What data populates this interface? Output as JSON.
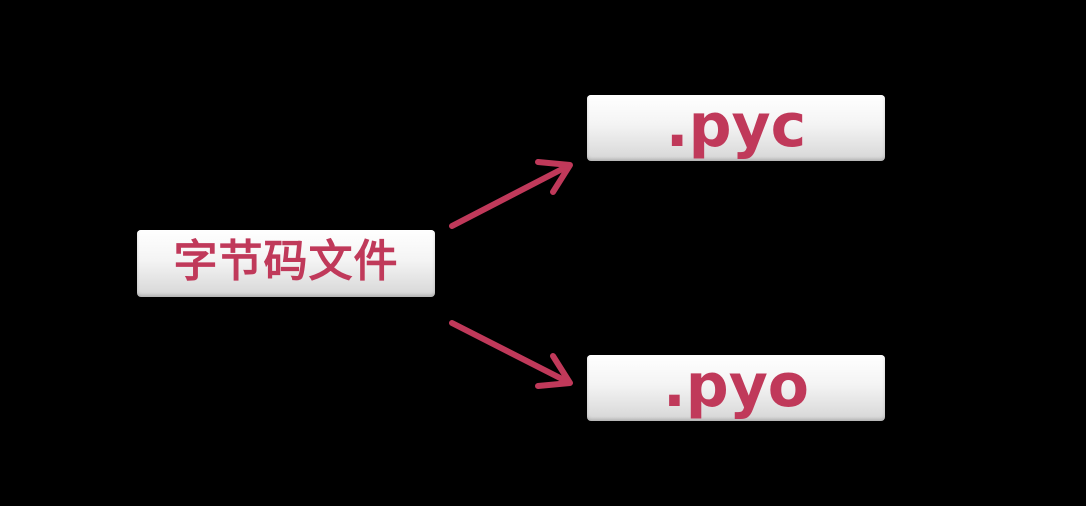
{
  "diagram": {
    "source_node": {
      "label": "字节码文件"
    },
    "targets": [
      {
        "label": ".pyc"
      },
      {
        "label": ".pyo"
      }
    ],
    "colors": {
      "background": "#000000",
      "node_text": "#c0395a",
      "arrow": "#c0395a",
      "node_fill": "#f2f2f2"
    }
  }
}
